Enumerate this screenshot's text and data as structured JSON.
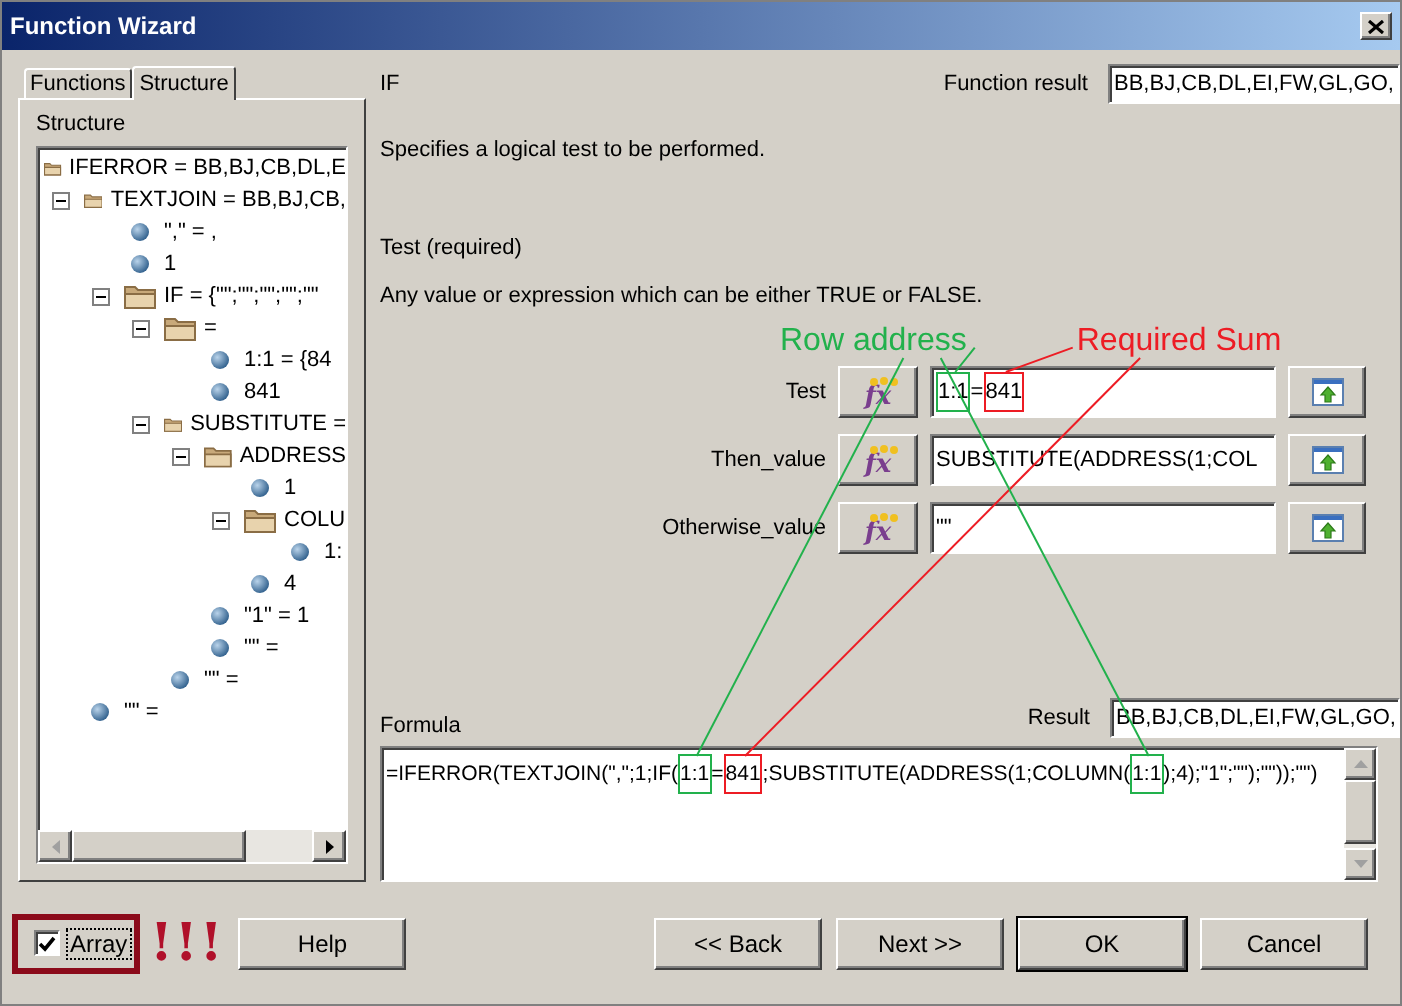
{
  "window": {
    "title": "Function Wizard"
  },
  "tabs": [
    {
      "label": "Functions",
      "selected": false
    },
    {
      "label": "Structure",
      "selected": true
    }
  ],
  "structure": {
    "label": "Structure",
    "tree": [
      {
        "label": "IFERROR = BB,BJ,CB,DL,E",
        "kind": "folder",
        "children": [
          {
            "label": "TEXTJOIN = BB,BJ,CB,",
            "kind": "folder",
            "expanded": true,
            "children": [
              {
                "label": "\",\" = ,",
                "kind": "value"
              },
              {
                "label": "1",
                "kind": "value"
              },
              {
                "label": "IF = {\"\";\"\";\"\";\"\";\"\"",
                "kind": "folder",
                "expanded": true,
                "children": [
                  {
                    "label": "=",
                    "kind": "folder",
                    "expanded": true,
                    "children": [
                      {
                        "label": "1:1 = {84",
                        "kind": "value"
                      },
                      {
                        "label": "841",
                        "kind": "value"
                      }
                    ]
                  },
                  {
                    "label": "SUBSTITUTE =",
                    "kind": "folder",
                    "expanded": true,
                    "children": [
                      {
                        "label": "ADDRESS",
                        "kind": "folder",
                        "expanded": true,
                        "children": [
                          {
                            "label": "1",
                            "kind": "value"
                          },
                          {
                            "label": "COLU",
                            "kind": "folder",
                            "expanded": true,
                            "children": [
                              {
                                "label": "1:",
                                "kind": "value"
                              }
                            ]
                          },
                          {
                            "label": "4",
                            "kind": "value"
                          }
                        ]
                      },
                      {
                        "label": "\"1\" = 1",
                        "kind": "value"
                      },
                      {
                        "label": "\"\" =",
                        "kind": "value"
                      }
                    ]
                  },
                  {
                    "label": "\"\" =",
                    "kind": "value"
                  }
                ]
              }
            ]
          },
          {
            "label": "\"\" =",
            "kind": "value"
          }
        ]
      }
    ]
  },
  "function": {
    "name": "IF",
    "result_label": "Function result",
    "result": "BB,BJ,CB,DL,EI,FW,GL,GO,",
    "description": "Specifies a logical test to be performed.",
    "argument_title": "Test (required)",
    "argument_help": "Any value or expression which can be either TRUE or FALSE."
  },
  "annotations": [
    {
      "text": "Row address",
      "color": "#22b14c"
    },
    {
      "text": "Required Sum",
      "color": "#ed1c24"
    }
  ],
  "arguments": [
    {
      "label": "Test",
      "function_button": "fx",
      "value_parts": [
        {
          "text": "1:1",
          "color": "#22b14c"
        },
        {
          "text": "="
        },
        {
          "text": "841",
          "color": "#ed1c24"
        }
      ]
    },
    {
      "label": "Then_value",
      "function_button": "fx",
      "value_parts": [
        {
          "text": "SUBSTITUTE(ADDRESS(1;COL"
        }
      ]
    },
    {
      "label": "Otherwise_value",
      "function_button": "fx",
      "value_parts": [
        {
          "text": "\"\""
        }
      ]
    }
  ],
  "formula": {
    "label": "Formula",
    "result_label": "Result",
    "result": "BB,BJ,CB,DL,EI,FW,GL,GO,",
    "parts": [
      {
        "text": "=IFERROR(TEXTJOIN(\",\";1;IF("
      },
      {
        "text": "1:1",
        "color": "#22b14c"
      },
      {
        "text": "="
      },
      {
        "text": "841",
        "color": "#ed1c24"
      },
      {
        "text": ";SUBSTITUTE(ADDRESS(1;COLUMN("
      },
      {
        "text": "1:1",
        "color": "#22b14c"
      },
      {
        "text": ");4);\"1\";\"\");\"\"));\"\")"
      }
    ]
  },
  "array": {
    "label": "Array",
    "checked": true,
    "annotation": "!!!"
  },
  "buttons": [
    {
      "label": "Help",
      "default": false
    },
    {
      "label": "<< Back",
      "default": false
    },
    {
      "label": "Next >>",
      "default": false
    },
    {
      "label": "OK",
      "default": true
    },
    {
      "label": "Cancel",
      "default": false
    }
  ]
}
